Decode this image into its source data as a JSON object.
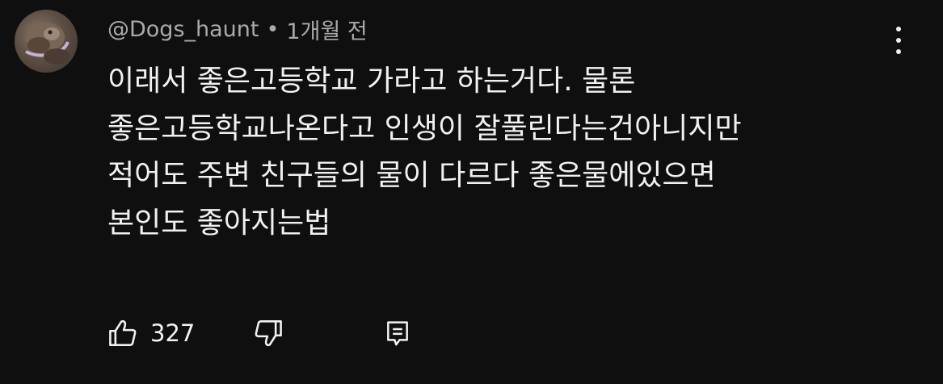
{
  "comment": {
    "author": "@Dogs_haunt",
    "separator": "•",
    "time": "1개월 전",
    "lines": [
      "이래서 좋은고등학교 가라고 하는거다. 물론",
      "좋은고등학교나온다고 인생이 잘풀린다는건아니지만",
      "적어도 주변 친구들의 물이 다르다 좋은물에있으면",
      "본인도 좋아지는법"
    ],
    "likes": "327",
    "icons": {
      "like": "thumbs-up-icon",
      "dislike": "thumbs-down-icon",
      "reply": "reply-icon",
      "menu": "more-vertical-icon"
    }
  },
  "colors": {
    "background": "#0f0f0f",
    "text": "#f1f1f1",
    "meta": "#aaaaaa"
  }
}
